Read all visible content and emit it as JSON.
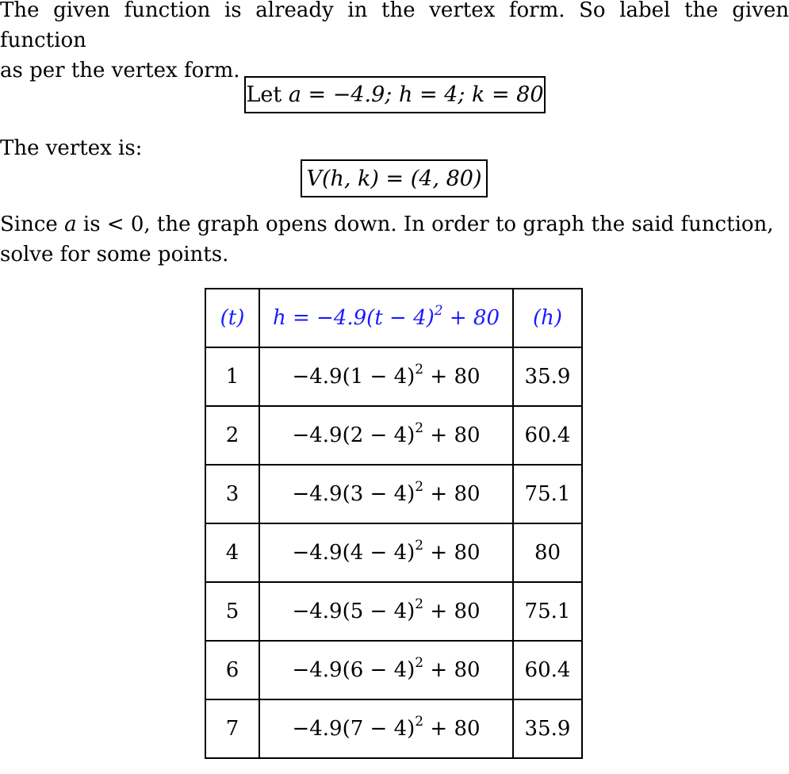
{
  "intro": {
    "line1": "The given function is already in the vertex form. So label the given function",
    "line2": "as per the vertex form."
  },
  "params_box": {
    "let": "Let",
    "expr": "a = −4.9; h = 4; k = 80"
  },
  "vertex": {
    "label": "The vertex is:",
    "expr": "V(h, k) = (4, 80)"
  },
  "explanation": {
    "line1_pre": "Since",
    "var": "a",
    "line1_post": "is < 0, the graph opens down. In order to graph the said function,",
    "line2": "solve for some points."
  },
  "table": {
    "header": {
      "t": "(t)",
      "formula_base": "h = −4.9(t − 4)",
      "formula_exp": "2",
      "formula_tail": " + 80",
      "h": "(h)"
    },
    "accent_color": "#1a1aff",
    "rows": [
      {
        "t": "1",
        "base": "−4.9(1 − 4)",
        "exp": "2",
        "tail": " + 80",
        "h": "35.9"
      },
      {
        "t": "2",
        "base": "−4.9(2 − 4)",
        "exp": "2",
        "tail": " + 80",
        "h": "60.4"
      },
      {
        "t": "3",
        "base": "−4.9(3 − 4)",
        "exp": "2",
        "tail": " + 80",
        "h": "75.1"
      },
      {
        "t": "4",
        "base": "−4.9(4 − 4)",
        "exp": "2",
        "tail": " + 80",
        "h": "80"
      },
      {
        "t": "5",
        "base": "−4.9(5 − 4)",
        "exp": "2",
        "tail": " + 80",
        "h": "75.1"
      },
      {
        "t": "6",
        "base": "−4.9(6 − 4)",
        "exp": "2",
        "tail": " + 80",
        "h": "60.4"
      },
      {
        "t": "7",
        "base": "−4.9(7 − 4)",
        "exp": "2",
        "tail": " + 80",
        "h": "35.9"
      }
    ]
  }
}
